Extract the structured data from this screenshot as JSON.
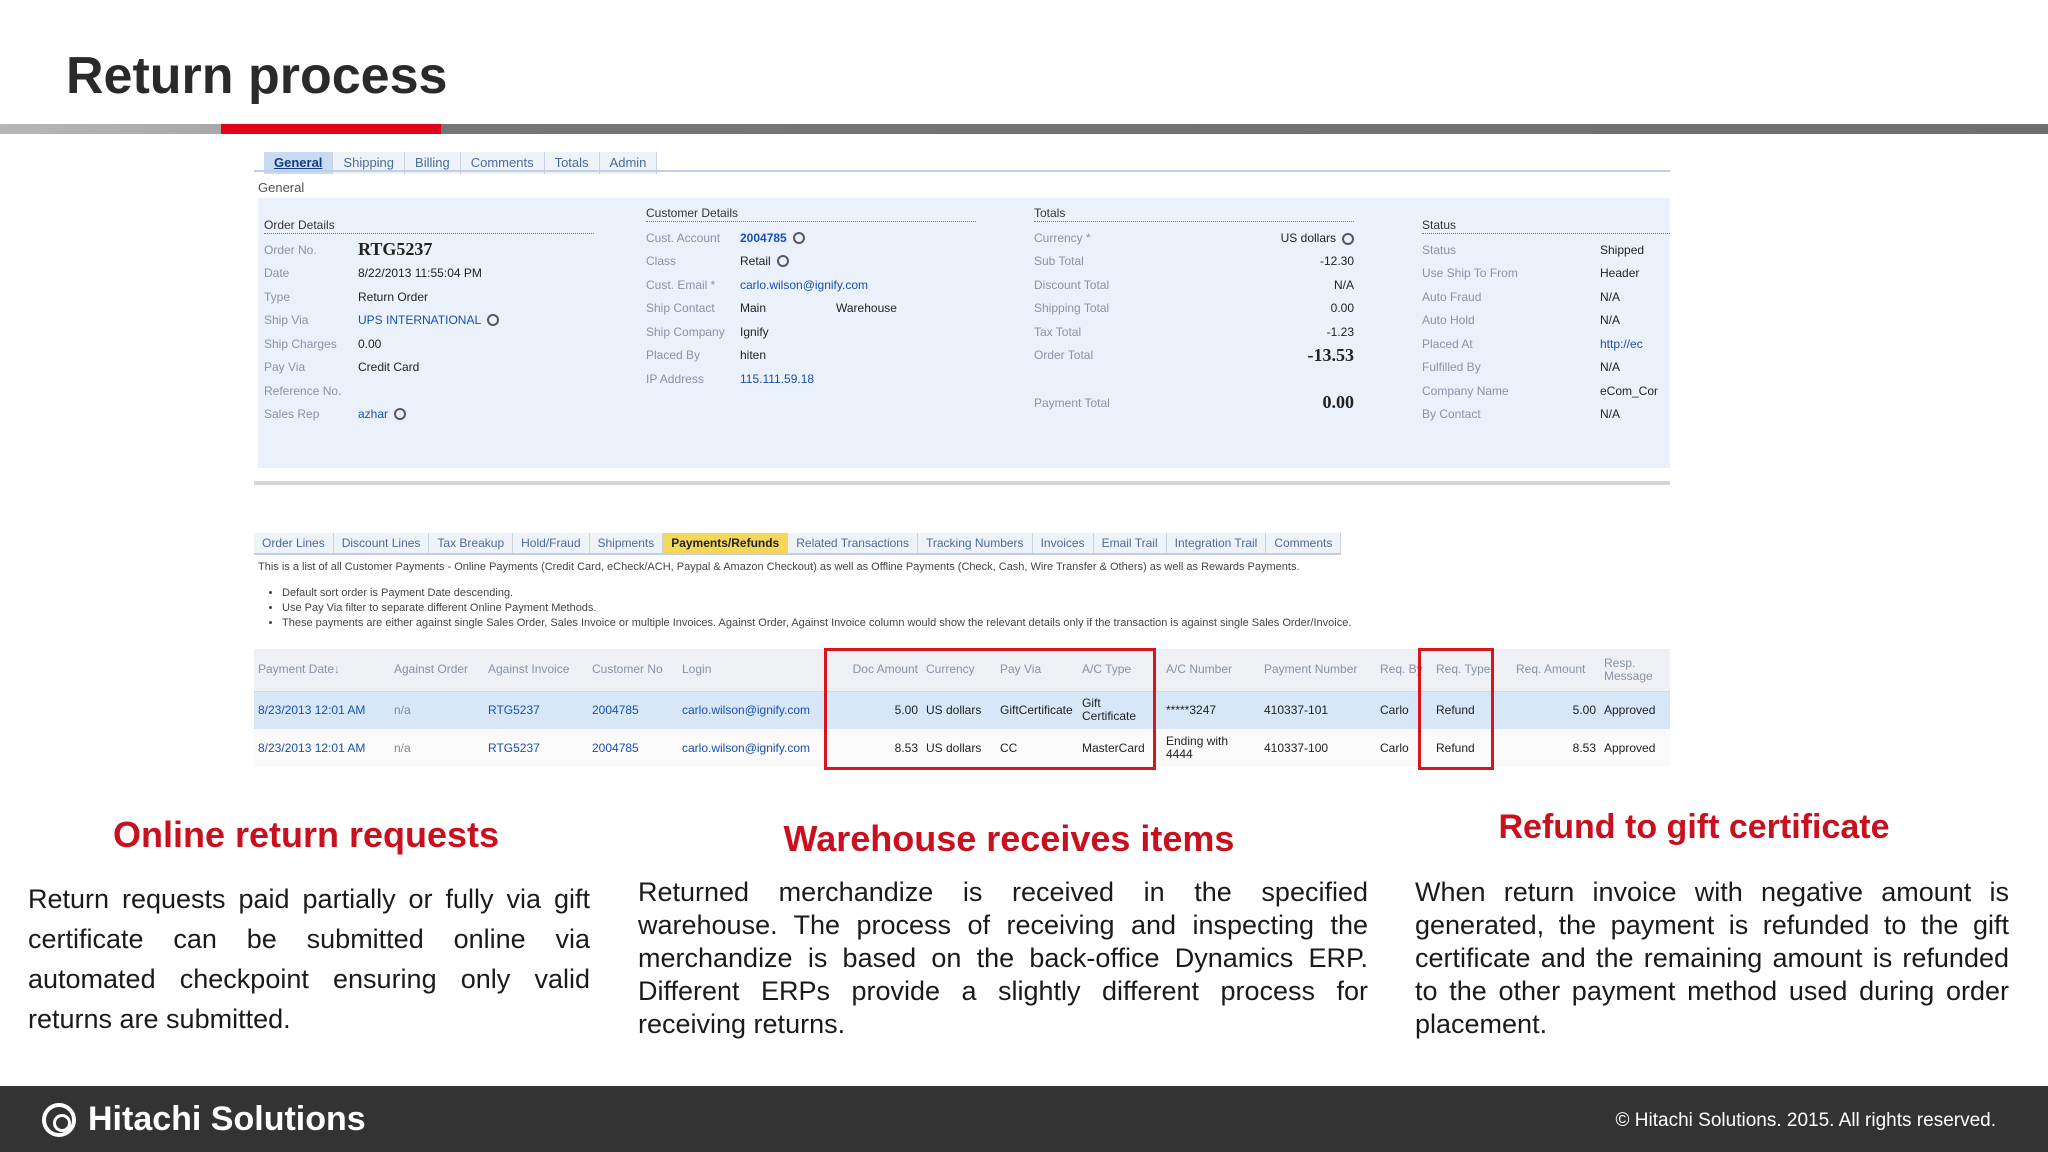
{
  "slide": {
    "title": "Return process"
  },
  "order_form": {
    "tabs": [
      "General",
      "Shipping",
      "Billing",
      "Comments",
      "Totals",
      "Admin"
    ],
    "section_label": "General",
    "order_details": {
      "heading": "Order Details",
      "rows": [
        {
          "label": "Order No.",
          "value": "RTG5237"
        },
        {
          "label": "Date",
          "value": "8/22/2013 11:55:04 PM"
        },
        {
          "label": "Type",
          "value": "Return Order"
        },
        {
          "label": "Ship Via",
          "value": "UPS INTERNATIONAL"
        },
        {
          "label": "Ship Charges",
          "value": "0.00"
        },
        {
          "label": "Pay Via",
          "value": "Credit Card"
        },
        {
          "label": "Reference No.",
          "value": ""
        },
        {
          "label": "Sales Rep",
          "value": "azhar"
        }
      ]
    },
    "customer_details": {
      "heading": "Customer Details",
      "rows": [
        {
          "label": "Cust. Account",
          "value": "2004785"
        },
        {
          "label": "Class",
          "value": "Retail"
        },
        {
          "label": "Cust. Email *",
          "value": "carlo.wilson@ignify.com"
        },
        {
          "label": "Ship Contact",
          "value": "Main",
          "extra": "Warehouse"
        },
        {
          "label": "Ship Company",
          "value": "Ignify"
        },
        {
          "label": "Placed By",
          "value": "hiten"
        },
        {
          "label": "IP Address",
          "value": "115.111.59.18"
        }
      ]
    },
    "totals": {
      "heading": "Totals",
      "rows": [
        {
          "label": "Currency *",
          "value": "US dollars"
        },
        {
          "label": "Sub Total",
          "value": "-12.30"
        },
        {
          "label": "Discount Total",
          "value": "N/A"
        },
        {
          "label": "Shipping Total",
          "value": "0.00"
        },
        {
          "label": "Tax Total",
          "value": "-1.23"
        },
        {
          "label": "Order Total",
          "value": "-13.53"
        }
      ],
      "payment_total_label": "Payment Total",
      "payment_total_value": "0.00"
    },
    "status": {
      "heading": "Status",
      "rows": [
        {
          "label": "Status",
          "value": "Shipped"
        },
        {
          "label": "Use Ship To From",
          "value": "Header"
        },
        {
          "label": "Auto Fraud",
          "value": "N/A"
        },
        {
          "label": "Auto Hold",
          "value": "N/A"
        },
        {
          "label": "Placed At",
          "value": "http://ec"
        },
        {
          "label": "Fulfilled By",
          "value": "N/A"
        },
        {
          "label": "Company Name",
          "value": "eCom_Con"
        },
        {
          "label": "By Contact",
          "value": "N/A"
        }
      ]
    }
  },
  "payments": {
    "tabs": [
      "Order Lines",
      "Discount Lines",
      "Tax Breakup",
      "Hold/Fraud",
      "Shipments",
      "Payments/Refunds",
      "Related Transactions",
      "Tracking Numbers",
      "Invoices",
      "Email Trail",
      "Integration Trail",
      "Comments"
    ],
    "description": "This is a list of all Customer Payments - Online Payments (Credit Card, eCheck/ACH, Paypal & Amazon Checkout) as well as Offline Payments (Check, Cash, Wire Transfer & Others) as well as Rewards Payments.",
    "bullets": [
      "Default sort order is Payment Date descending.",
      "Use Pay Via filter to separate different Online Payment Methods.",
      "These payments are either against single Sales Order, Sales Invoice or multiple Invoices. Against Order, Against Invoice column would show the relevant details only if the transaction is against single Sales Order/Invoice."
    ],
    "columns": [
      "Payment Date↓",
      "Against Order",
      "Against Invoice",
      "Customer No",
      "Login",
      "Doc Amount",
      "Currency",
      "Pay Via",
      "A/C Type",
      "A/C Number",
      "Payment Number",
      "Req. By",
      "Req. Type",
      "Req. Amount",
      "Resp. Message"
    ],
    "rows": [
      [
        "8/23/2013 12:01 AM",
        "n/a",
        "RTG5237",
        "2004785",
        "carlo.wilson@ignify.com",
        "5.00",
        "US dollars",
        "GiftCertificate",
        "Gift Certificate",
        "*****3247",
        "410337-101",
        "Carlo",
        "Refund",
        "5.00",
        "Approved"
      ],
      [
        "8/23/2013 12:01 AM",
        "n/a",
        "RTG5237",
        "2004785",
        "carlo.wilson@ignify.com",
        "8.53",
        "US dollars",
        "CC",
        "MasterCard",
        "Ending with 4444",
        "410337-100",
        "Carlo",
        "Refund",
        "8.53",
        "Approved"
      ]
    ]
  },
  "captions": [
    {
      "heading": "Online return requests",
      "text": "Return requests paid partially or fully via gift certificate can be submitted online via automated checkpoint ensuring only valid returns are submitted."
    },
    {
      "heading": "Warehouse receives items",
      "text": "Returned merchandize is received in the specified warehouse. The process of receiving and inspecting the merchandize is based on the back-office Dynamics ERP. Different ERPs provide a slightly different process for receiving returns."
    },
    {
      "heading": "Refund to gift certificate",
      "text": "When return invoice with negative amount is generated, the payment is refunded to the gift certificate and the remaining amount is refunded to the other payment method used during order placement."
    }
  ],
  "footer": {
    "logo_text": "Hitachi Solutions",
    "copyright": "©  Hitachi Solutions. 2015. All rights reserved."
  },
  "colors": {
    "accent_red": "#e2001a",
    "caption_red": "#c8101e",
    "footer_bg": "#333333",
    "highlight_tab": "#f6d75a"
  }
}
